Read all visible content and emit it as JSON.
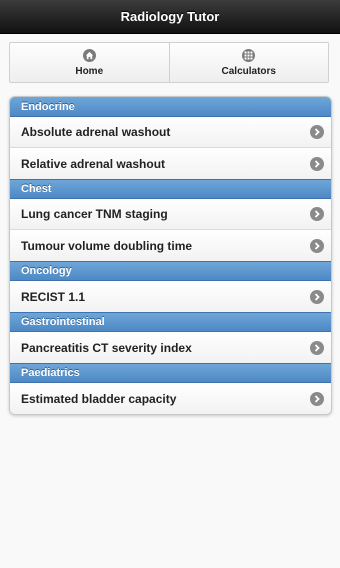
{
  "app": {
    "title": "Radiology Tutor"
  },
  "nav": [
    {
      "label": "Home",
      "icon": "home-icon"
    },
    {
      "label": "Calculators",
      "icon": "grid-icon"
    }
  ],
  "groups": [
    {
      "title": "Endocrine",
      "items": [
        "Absolute adrenal washout",
        "Relative adrenal washout"
      ]
    },
    {
      "title": "Chest",
      "items": [
        "Lung cancer TNM staging",
        "Tumour volume doubling time"
      ]
    },
    {
      "title": "Oncology",
      "items": [
        "RECIST 1.1"
      ]
    },
    {
      "title": "Gastrointestinal",
      "items": [
        "Pancreatitis CT severity index"
      ]
    },
    {
      "title": "Paediatrics",
      "items": [
        "Estimated bladder capacity"
      ]
    }
  ],
  "colors": {
    "header": "#1a1a1a",
    "divider": "#5c95cf",
    "chevron": "#8a8a8a"
  }
}
